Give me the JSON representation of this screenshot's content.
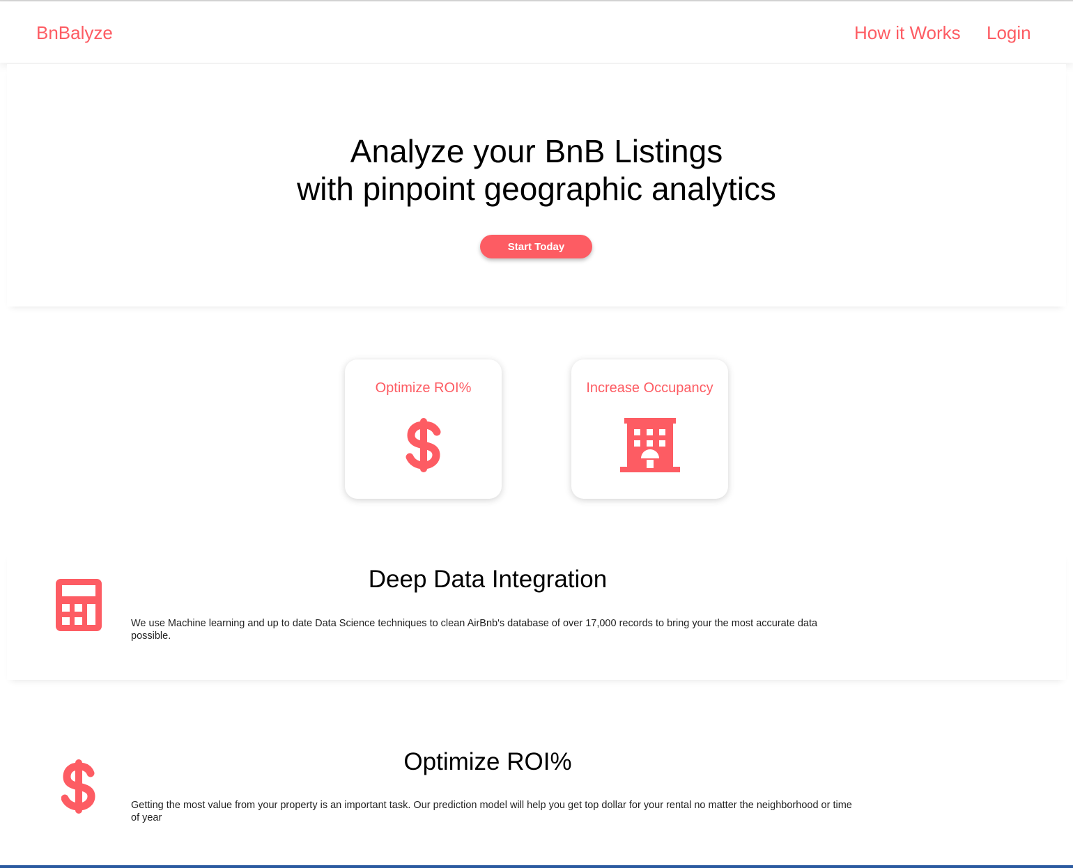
{
  "nav": {
    "brand": "BnBalyze",
    "links": [
      "How it Works",
      "Login"
    ]
  },
  "hero": {
    "title_line1": "Analyze your BnB Listings",
    "title_line2": "with pinpoint geographic analytics",
    "cta_label": "Start Today"
  },
  "cards": [
    {
      "title": "Optimize ROI%",
      "icon": "dollar-icon"
    },
    {
      "title": "Increase Occupancy",
      "icon": "building-icon"
    }
  ],
  "sections": [
    {
      "title": "Deep Data Integration",
      "icon": "calculator-icon",
      "text": "We use Machine learning and up to date Data Science techniques to clean AirBnb's database of over 17,000 records to bring your the most accurate data possible."
    },
    {
      "title": "Optimize ROI%",
      "icon": "dollar-icon",
      "text": "Getting the most value from your property is an important task. Our prediction model will help you get top dollar for your rental no matter the neighborhood or time of year"
    }
  ],
  "colors": {
    "accent": "#fd5c63",
    "text": "#000000",
    "background": "#ffffff"
  }
}
